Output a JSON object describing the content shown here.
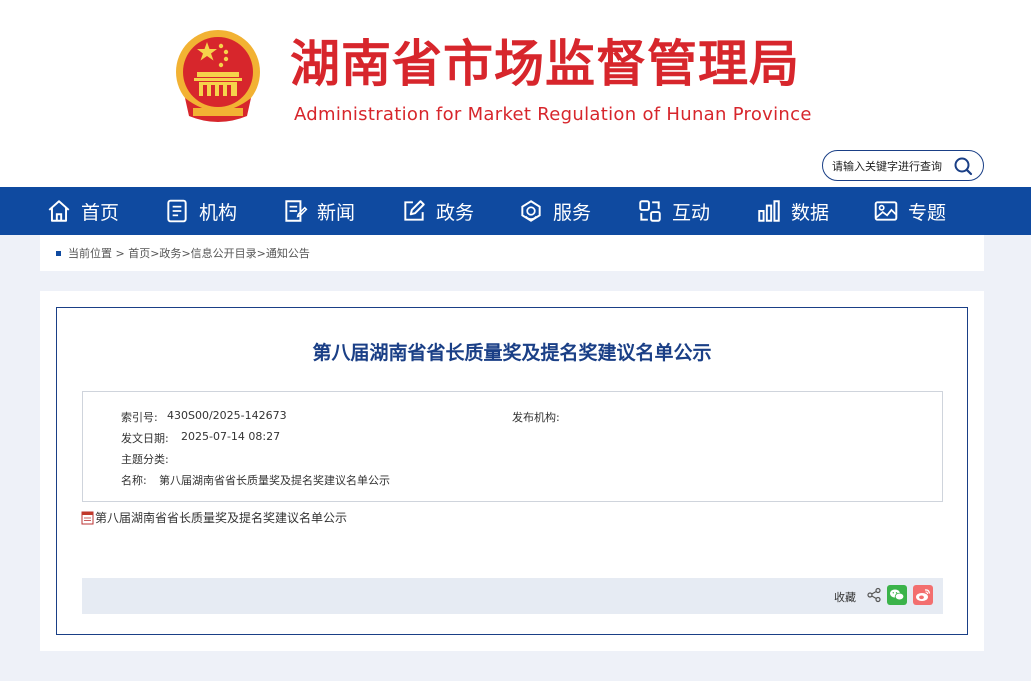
{
  "header": {
    "title": "湖南省市场监督管理局",
    "subtitle": "Administration for Market Regulation of Hunan Province",
    "search_placeholder": "请输入关键字进行查询"
  },
  "nav": {
    "items": [
      {
        "label": "首页",
        "icon": "home-icon"
      },
      {
        "label": "机构",
        "icon": "book-icon"
      },
      {
        "label": "新闻",
        "icon": "news-icon"
      },
      {
        "label": "政务",
        "icon": "edit-icon"
      },
      {
        "label": "服务",
        "icon": "service-icon"
      },
      {
        "label": "互动",
        "icon": "interact-icon"
      },
      {
        "label": "数据",
        "icon": "chart-icon"
      },
      {
        "label": "专题",
        "icon": "image-icon"
      }
    ]
  },
  "breadcrumb": {
    "prefix": "当前位置 > ",
    "items": [
      "首页",
      ">政务",
      ">信息公开目录",
      ">通知公告"
    ]
  },
  "article": {
    "title": "第八届湖南省省长质量奖及提名奖建议名单公示",
    "meta": {
      "index_label": "索引号:",
      "index_value": "430S00/2025-142673",
      "publisher_label": "发布机构:",
      "publisher_value": "",
      "date_label": "发文日期:",
      "date_value": "2025-07-14 08:27",
      "topic_label": "主题分类:",
      "topic_value": "",
      "name_label": "名称:",
      "name_value": "第八届湖南省省长质量奖及提名奖建议名单公示"
    },
    "attachment": "第八届湖南省省长质量奖及提名奖建议名单公示"
  },
  "share": {
    "collect_label": "收藏"
  },
  "colors": {
    "brand_red": "#d7262c",
    "nav_blue": "#0f4aa0",
    "title_blue": "#1a3f86",
    "wechat_green": "#3bb34a",
    "weibo_red": "#f36f6f"
  }
}
